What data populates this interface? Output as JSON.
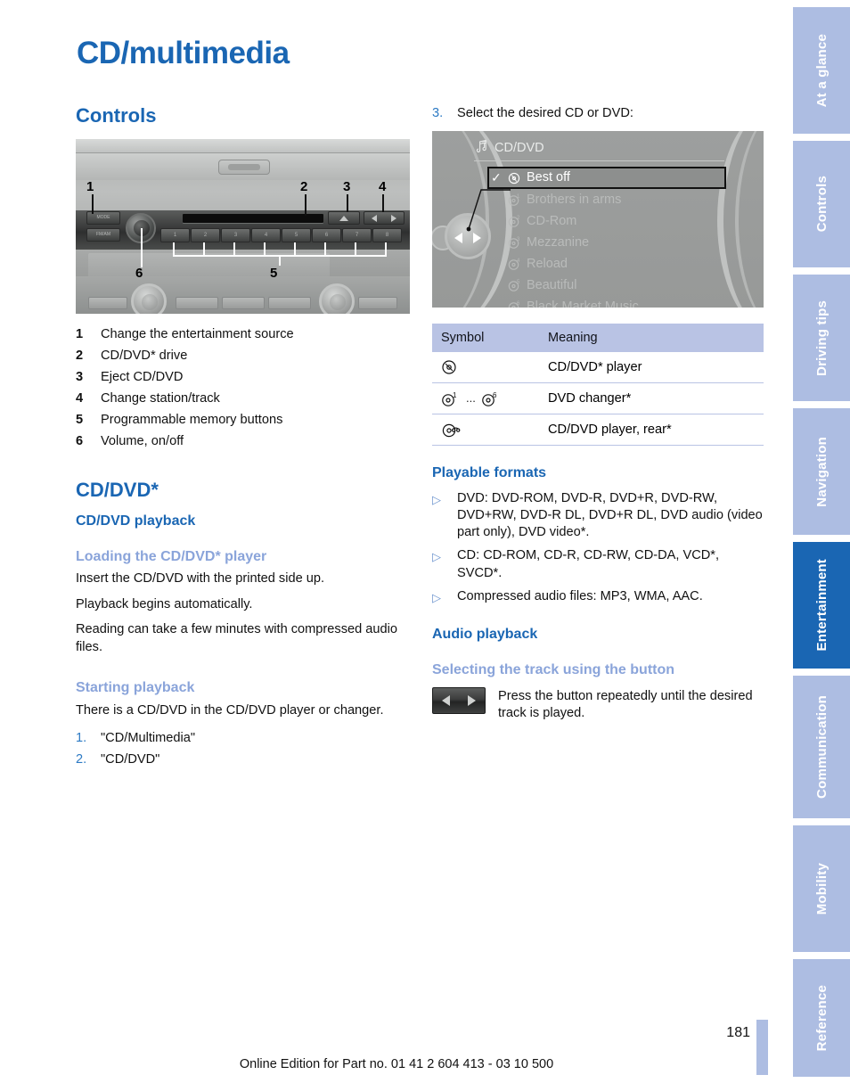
{
  "document": {
    "title": "CD/multimedia",
    "page_number": "181",
    "footer": "Online Edition for Part no. 01 41 2 604 413 - 03 10 500",
    "accent_blue": "#1a66b3",
    "accent_light_blue": "#8aa4da",
    "tab_blue": "#adbde2",
    "table_header_blue": "#b9c3e4"
  },
  "left_column": {
    "controls_heading": "Controls",
    "radio_figure": {
      "name": "car-radio-control-panel",
      "mode_button": "MODE",
      "fmam_button": "FM/AM",
      "memory_buttons": [
        "1",
        "2",
        "3",
        "4",
        "5",
        "6",
        "7",
        "8"
      ],
      "callouts": [
        "1",
        "2",
        "3",
        "4",
        "5",
        "6"
      ]
    },
    "legend": [
      {
        "num": "1",
        "text": "Change the entertainment source"
      },
      {
        "num": "2",
        "text": "CD/DVD* drive"
      },
      {
        "num": "3",
        "text": "Eject CD/DVD"
      },
      {
        "num": "4",
        "text": "Change station/track"
      },
      {
        "num": "5",
        "text": "Programmable memory buttons"
      },
      {
        "num": "6",
        "text": "Volume, on/off"
      }
    ],
    "cddvd_heading": "CD/DVD*",
    "playback_heading": "CD/DVD playback",
    "loading_heading": "Loading the CD/DVD* player",
    "loading_p1": "Insert the CD/DVD with the printed side up.",
    "loading_p2": "Playback begins automatically.",
    "loading_p3": "Reading can take a few minutes with compressed audio files.",
    "starting_heading": "Starting playback",
    "starting_p1": "There is a CD/DVD in the CD/DVD player or changer.",
    "steps": [
      {
        "num": "1.",
        "text": "\"CD/Multimedia\""
      },
      {
        "num": "2.",
        "text": "\"CD/DVD\""
      }
    ]
  },
  "right_column": {
    "step3": {
      "num": "3.",
      "text": "Select the desired CD or DVD:"
    },
    "idrive": {
      "header_label": "CD/DVD",
      "header_icon": "music-note-icon",
      "checkmark": "✓",
      "items": [
        {
          "label": "Best off",
          "disc_num": "",
          "selected": true
        },
        {
          "label": "Brothers in arms",
          "disc_num": "1",
          "selected": false
        },
        {
          "label": "CD-Rom",
          "disc_num": "2",
          "selected": false
        },
        {
          "label": "Mezzanine",
          "disc_num": "3",
          "selected": false
        },
        {
          "label": "Reload",
          "disc_num": "4",
          "selected": false
        },
        {
          "label": "Beautiful",
          "disc_num": "5",
          "selected": false
        },
        {
          "label": "Black Market Music",
          "disc_num": "6",
          "selected": false
        }
      ],
      "controller": "left-right-rocker-control"
    },
    "symbol_table": {
      "headers": [
        "Symbol",
        "Meaning"
      ],
      "rows": [
        {
          "symbol": "disc-icon",
          "disc_num": "",
          "meaning": "CD/DVD* player"
        },
        {
          "symbol": "disc-range-icon",
          "disc_num": "1",
          "disc_num2": "6",
          "dots": "...",
          "meaning": "DVD changer*"
        },
        {
          "symbol": "disc-headphone-icon",
          "disc_num": "",
          "meaning": "CD/DVD player, rear*"
        }
      ]
    },
    "playable_heading": "Playable formats",
    "bullets": [
      "DVD: DVD-ROM, DVD-R, DVD+R, DVD-RW, DVD+RW, DVD-R DL, DVD+R DL, DVD audio (video part only), DVD video*.",
      "CD: CD-ROM, CD-R, CD-RW, CD-DA, VCD*, SVCD*.",
      "Compressed audio files: MP3, WMA, AAC."
    ],
    "audio_heading": "Audio playback",
    "selecting_heading": "Selecting the track using the button",
    "track_text": "Press the button repeatedly until the desired track is played."
  },
  "side_tabs": [
    {
      "label": "At a glance",
      "active": false
    },
    {
      "label": "Controls",
      "active": false
    },
    {
      "label": "Driving tips",
      "active": false
    },
    {
      "label": "Navigation",
      "active": false
    },
    {
      "label": "Entertainment",
      "active": true
    },
    {
      "label": "Communication",
      "active": false
    },
    {
      "label": "Mobility",
      "active": false
    },
    {
      "label": "Reference",
      "active": false
    }
  ]
}
